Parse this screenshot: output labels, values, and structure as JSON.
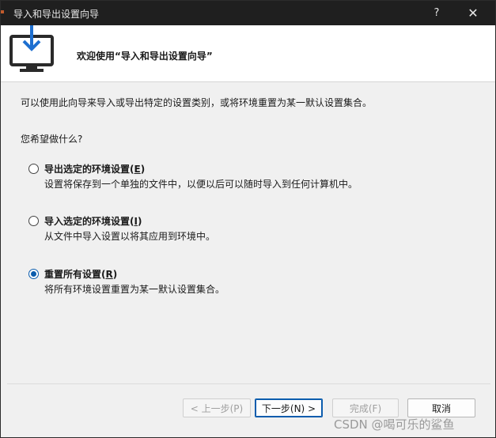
{
  "window": {
    "title": "导入和导出设置向导",
    "help_glyph": "?",
    "close_glyph": "✕"
  },
  "header": {
    "title": "欢迎使用“导入和导出设置向导”"
  },
  "content": {
    "intro": "可以使用此向导来导入或导出特定的设置类别，或将环境重置为某一默认设置集合。",
    "question": "您希望做什么?",
    "options": [
      {
        "label_main": "导出选定的环境设置(",
        "label_key": "E",
        "label_end": ")",
        "description": "设置将保存到一个单独的文件中，以便以后可以随时导入到任何计算机中。",
        "checked": false
      },
      {
        "label_main": "导入选定的环境设置(",
        "label_key": "I",
        "label_end": ")",
        "description": "从文件中导入设置以将其应用到环境中。",
        "checked": false
      },
      {
        "label_main": "重置所有设置(",
        "label_key": "R",
        "label_end": ")",
        "description": "将所有环境设置重置为某一默认设置集合。",
        "checked": true
      }
    ]
  },
  "buttons": {
    "back": "< 上一步(P)",
    "next": "下一步(N) >",
    "finish": "完成(F)",
    "cancel": "取消"
  },
  "watermark": "CSDN @喝可乐的鲨鱼",
  "colors": {
    "accent": "#0b5cad",
    "titlebar": "#1f1f1f",
    "icon_blue": "#1e6fd0"
  }
}
